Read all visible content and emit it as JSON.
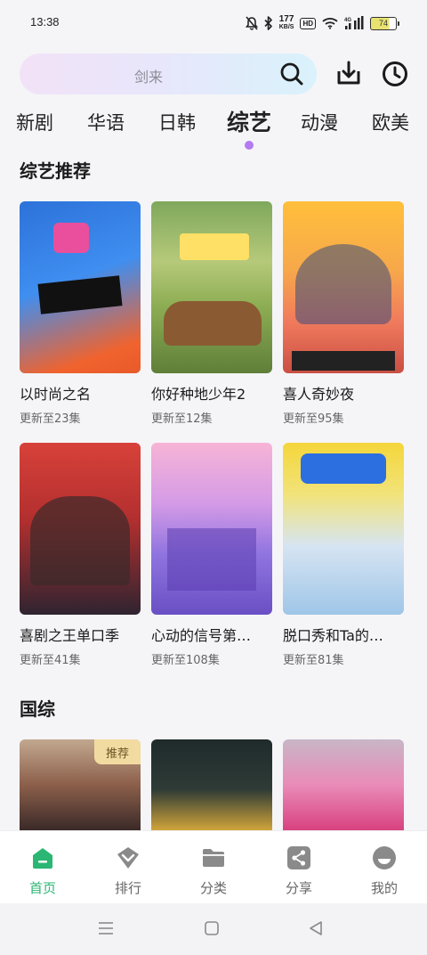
{
  "status_bar": {
    "time": "13:38",
    "net_speed": "177",
    "net_unit": "KB/S",
    "hd": "HD",
    "signal": "4G",
    "battery": "74",
    "icons": [
      "mute-bell-icon",
      "bluetooth-icon",
      "wifi-icon",
      "cellular-signal-icon",
      "battery-icon"
    ]
  },
  "search": {
    "placeholder": "剑来"
  },
  "tabs": [
    "新剧",
    "华语",
    "日韩",
    "综艺",
    "动漫",
    "欧美"
  ],
  "active_tab_index": 3,
  "sections": [
    {
      "title": "综艺推荐",
      "items": [
        {
          "title": "以时尚之名",
          "subtitle": "更新至23集"
        },
        {
          "title": "你好种地少年2",
          "subtitle": "更新至12集"
        },
        {
          "title": "喜人奇妙夜",
          "subtitle": "更新至95集"
        },
        {
          "title": "喜剧之王单口季",
          "subtitle": "更新至41集"
        },
        {
          "title": "心动的信号第…",
          "subtitle": "更新至108集"
        },
        {
          "title": "脱口秀和Ta的…",
          "subtitle": "更新至81集"
        }
      ]
    },
    {
      "title": "国综",
      "items": [
        {
          "badge": "推荐"
        },
        {},
        {}
      ]
    }
  ],
  "bottom_nav": [
    {
      "label": "首页",
      "icon": "home-icon",
      "active": true
    },
    {
      "label": "排行",
      "icon": "ranking-icon",
      "active": false
    },
    {
      "label": "分类",
      "icon": "folder-icon",
      "active": false
    },
    {
      "label": "分享",
      "icon": "share-icon",
      "active": false
    },
    {
      "label": "我的",
      "icon": "profile-icon",
      "active": false
    }
  ],
  "colors": {
    "accent_green": "#2bb673",
    "tab_indicator": "#b47cf0",
    "background": "#f5f5f8"
  }
}
